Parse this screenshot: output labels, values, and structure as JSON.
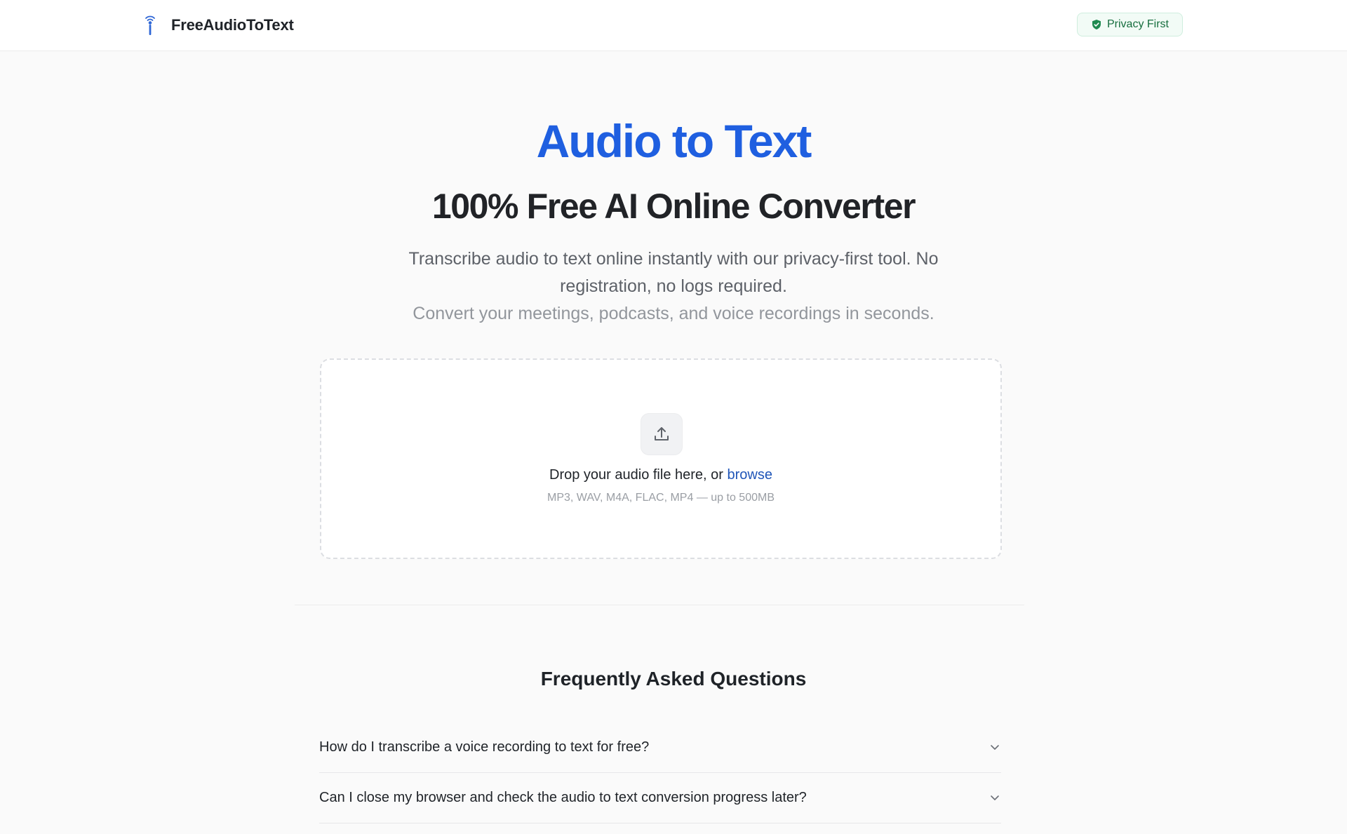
{
  "header": {
    "brand_name": "FreeAudioToText",
    "privacy_badge": "Privacy First"
  },
  "hero": {
    "title": "Audio to Text",
    "subtitle": "100% Free AI Online Converter",
    "description": "Transcribe audio to text online instantly with our privacy-first tool. No registration, no logs required.",
    "description_secondary": "Convert your meetings, podcasts, and voice recordings in seconds."
  },
  "upload": {
    "drop_text": "Drop your audio file here, or",
    "browse_label": "browse",
    "formats": "MP3, WAV, M4A, FLAC, MP4 — up to 500MB"
  },
  "faq": {
    "title": "Frequently Asked Questions",
    "items": [
      {
        "question": "How do I transcribe a voice recording to text for free?"
      },
      {
        "question": "Can I close my browser and check the audio to text conversion progress later?"
      }
    ]
  },
  "colors": {
    "accent": "#1f5fe0",
    "link": "#1f55b8",
    "badge_green": "#166e3e",
    "background": "#fafafa"
  },
  "icons": {
    "brand": "radio-tower-icon",
    "badge": "shield-check-icon",
    "upload": "upload-icon",
    "faq_toggle": "chevron-down-icon"
  }
}
